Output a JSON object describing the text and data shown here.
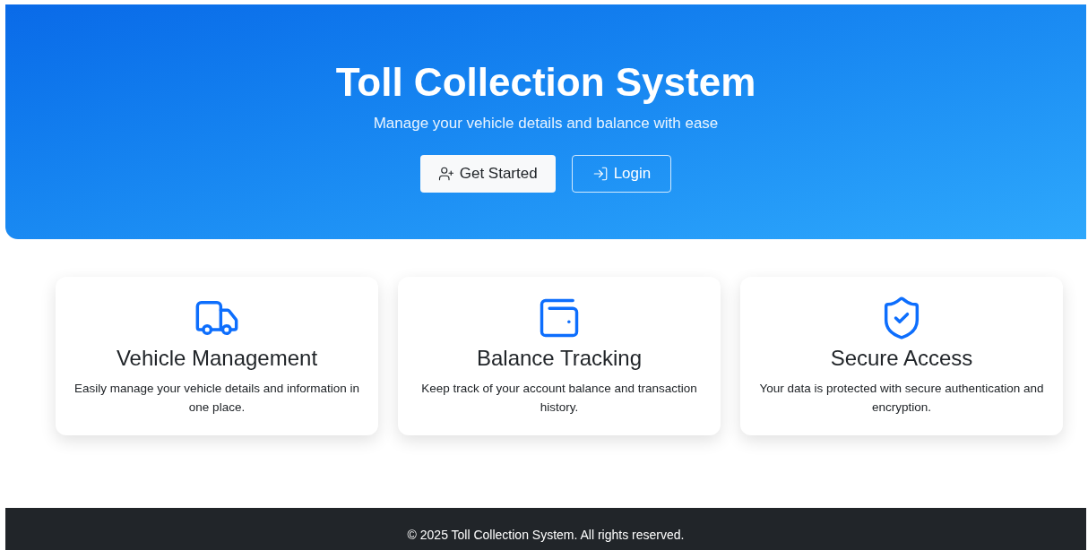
{
  "hero": {
    "title": "Toll Collection System",
    "subtitle": "Manage your vehicle details and balance with ease",
    "buttons": [
      {
        "label": "Get Started",
        "kind": "filled"
      },
      {
        "label": "Login",
        "kind": "outline"
      }
    ]
  },
  "features": [
    {
      "kind": "truck",
      "title": "Vehicle Management",
      "text": "Easily manage your vehicle details and information in one place."
    },
    {
      "kind": "wallet",
      "title": "Balance Tracking",
      "text": "Keep track of your account balance and transaction history."
    },
    {
      "kind": "shield",
      "title": "Secure Access",
      "text": "Your data is protected with secure authentication and encryption."
    }
  ],
  "footer": {
    "text": "© 2025 Toll Collection System. All rights reserved."
  }
}
